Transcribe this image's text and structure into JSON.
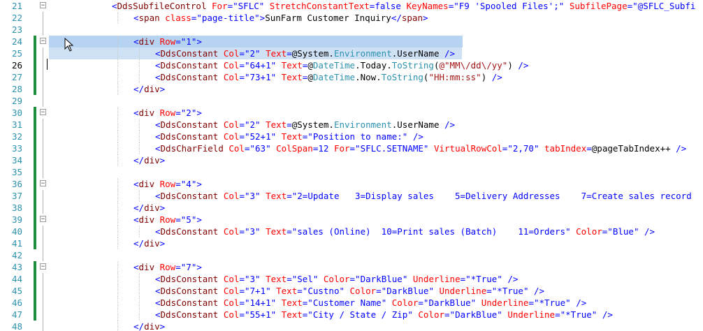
{
  "lines": [
    {
      "num": "21",
      "fold": "minus",
      "indent": 0,
      "tokens": [
        [
          "p",
          "<"
        ],
        [
          "t",
          "DdsSubfileControl"
        ],
        [
          "a",
          " For"
        ],
        [
          "p",
          "=\""
        ],
        [
          "v",
          "SFLC"
        ],
        [
          "p",
          "\""
        ],
        [
          "a",
          " StretchConstantText"
        ],
        [
          "p",
          "="
        ],
        [
          "v",
          "false"
        ],
        [
          "a",
          " KeyNames"
        ],
        [
          "p",
          "=\""
        ],
        [
          "v",
          "F9 'Spooled Files';"
        ],
        [
          "p",
          "\""
        ],
        [
          "a",
          " SubfilePage"
        ],
        [
          "p",
          "=\""
        ],
        [
          "v",
          "@SFLC_Subfi"
        ]
      ]
    },
    {
      "num": "22",
      "fold": "",
      "indent": 1,
      "tokens": [
        [
          "p",
          "<"
        ],
        [
          "t",
          "span"
        ],
        [
          "a",
          " class"
        ],
        [
          "p",
          "=\""
        ],
        [
          "v",
          "page-title"
        ],
        [
          "p",
          "\">"
        ],
        [
          "n",
          "SunFarm Customer Inquiry"
        ],
        [
          "p",
          "</"
        ],
        [
          "t",
          "span"
        ],
        [
          "p",
          ">"
        ]
      ]
    },
    {
      "num": "23",
      "fold": "",
      "indent": 0,
      "tokens": []
    },
    {
      "num": "24",
      "fold": "minus",
      "indent": 1,
      "tokens": [
        [
          "p",
          "<"
        ],
        [
          "t",
          "div"
        ],
        [
          "a",
          " Row"
        ],
        [
          "p",
          "=\""
        ],
        [
          "v",
          "1"
        ],
        [
          "p",
          "\">"
        ]
      ]
    },
    {
      "num": "25",
      "fold": "",
      "indent": 2,
      "tokens": [
        [
          "p",
          "<"
        ],
        [
          "t",
          "DdsConstant"
        ],
        [
          "a",
          " Col"
        ],
        [
          "p",
          "=\""
        ],
        [
          "v",
          "2"
        ],
        [
          "p",
          "\""
        ],
        [
          "a",
          " Text"
        ],
        [
          "p",
          "="
        ],
        [
          "n",
          "@System."
        ],
        [
          "k",
          "Environment"
        ],
        [
          "n",
          ".UserName"
        ],
        [
          "p",
          " />"
        ]
      ]
    },
    {
      "num": "26",
      "fold": "",
      "indent": 2,
      "tokens": [
        [
          "p",
          "<"
        ],
        [
          "t",
          "DdsConstant"
        ],
        [
          "a",
          " Col"
        ],
        [
          "p",
          "=\""
        ],
        [
          "v",
          "64+1"
        ],
        [
          "p",
          "\""
        ],
        [
          "a",
          " Text"
        ],
        [
          "p",
          "="
        ],
        [
          "n",
          "@"
        ],
        [
          "k",
          "DateTime"
        ],
        [
          "n",
          ".Today."
        ],
        [
          "k",
          "ToString"
        ],
        [
          "n",
          "("
        ],
        [
          "s",
          "@\"MM\\/dd\\/yy\""
        ],
        [
          "n",
          ")"
        ],
        [
          "p",
          " />"
        ]
      ]
    },
    {
      "num": "27",
      "fold": "",
      "indent": 2,
      "tokens": [
        [
          "p",
          "<"
        ],
        [
          "t",
          "DdsConstant"
        ],
        [
          "a",
          " Col"
        ],
        [
          "p",
          "=\""
        ],
        [
          "v",
          "73+1"
        ],
        [
          "p",
          "\""
        ],
        [
          "a",
          " Text"
        ],
        [
          "p",
          "="
        ],
        [
          "n",
          "@"
        ],
        [
          "k",
          "DateTime"
        ],
        [
          "n",
          ".Now."
        ],
        [
          "k",
          "ToString"
        ],
        [
          "n",
          "("
        ],
        [
          "s",
          "\"HH:mm:ss\""
        ],
        [
          "n",
          ")"
        ],
        [
          "p",
          " />"
        ]
      ]
    },
    {
      "num": "28",
      "fold": "",
      "indent": 1,
      "tokens": [
        [
          "p",
          "</"
        ],
        [
          "t",
          "div"
        ],
        [
          "p",
          ">"
        ]
      ]
    },
    {
      "num": "29",
      "fold": "",
      "indent": 0,
      "tokens": []
    },
    {
      "num": "30",
      "fold": "minus",
      "indent": 1,
      "tokens": [
        [
          "p",
          "<"
        ],
        [
          "t",
          "div"
        ],
        [
          "a",
          " Row"
        ],
        [
          "p",
          "=\""
        ],
        [
          "v",
          "2"
        ],
        [
          "p",
          "\">"
        ]
      ]
    },
    {
      "num": "31",
      "fold": "",
      "indent": 2,
      "tokens": [
        [
          "p",
          "<"
        ],
        [
          "t",
          "DdsConstant"
        ],
        [
          "a",
          " Col"
        ],
        [
          "p",
          "=\""
        ],
        [
          "v",
          "2"
        ],
        [
          "p",
          "\""
        ],
        [
          "a",
          " Text"
        ],
        [
          "p",
          "="
        ],
        [
          "n",
          "@System."
        ],
        [
          "k",
          "Environment"
        ],
        [
          "n",
          ".UserName"
        ],
        [
          "p",
          " />"
        ]
      ]
    },
    {
      "num": "32",
      "fold": "",
      "indent": 2,
      "tokens": [
        [
          "p",
          "<"
        ],
        [
          "t",
          "DdsConstant"
        ],
        [
          "a",
          " Col"
        ],
        [
          "p",
          "=\""
        ],
        [
          "v",
          "52+1"
        ],
        [
          "p",
          "\""
        ],
        [
          "a",
          " Text"
        ],
        [
          "p",
          "=\""
        ],
        [
          "v",
          "Position to name:"
        ],
        [
          "p",
          "\""
        ],
        [
          "p",
          " />"
        ]
      ]
    },
    {
      "num": "33",
      "fold": "",
      "indent": 2,
      "tokens": [
        [
          "p",
          "<"
        ],
        [
          "t",
          "DdsCharField"
        ],
        [
          "a",
          " Col"
        ],
        [
          "p",
          "=\""
        ],
        [
          "v",
          "63"
        ],
        [
          "p",
          "\""
        ],
        [
          "a",
          " ColSpan"
        ],
        [
          "p",
          "="
        ],
        [
          "v",
          "12"
        ],
        [
          "a",
          " For"
        ],
        [
          "p",
          "=\""
        ],
        [
          "v",
          "SFLC.SETNAME"
        ],
        [
          "p",
          "\""
        ],
        [
          "a",
          " VirtualRowCol"
        ],
        [
          "p",
          "=\""
        ],
        [
          "v",
          "2,70"
        ],
        [
          "p",
          "\""
        ],
        [
          "a",
          " tabIndex"
        ],
        [
          "p",
          "="
        ],
        [
          "n",
          "@pageTabIndex++"
        ],
        [
          "p",
          " />"
        ]
      ]
    },
    {
      "num": "34",
      "fold": "",
      "indent": 1,
      "tokens": [
        [
          "p",
          "</"
        ],
        [
          "t",
          "div"
        ],
        [
          "p",
          ">"
        ]
      ]
    },
    {
      "num": "35",
      "fold": "",
      "indent": 0,
      "tokens": []
    },
    {
      "num": "36",
      "fold": "minus",
      "indent": 1,
      "tokens": [
        [
          "p",
          "<"
        ],
        [
          "t",
          "div"
        ],
        [
          "a",
          " Row"
        ],
        [
          "p",
          "=\""
        ],
        [
          "v",
          "4"
        ],
        [
          "p",
          "\">"
        ]
      ]
    },
    {
      "num": "37",
      "fold": "",
      "indent": 2,
      "tokens": [
        [
          "p",
          "<"
        ],
        [
          "t",
          "DdsConstant"
        ],
        [
          "a",
          " Col"
        ],
        [
          "p",
          "=\""
        ],
        [
          "v",
          "3"
        ],
        [
          "p",
          "\""
        ],
        [
          "a",
          " Text"
        ],
        [
          "p",
          "=\""
        ],
        [
          "v",
          "2=Update   3=Display sales    5=Delivery Addresses    7=Create sales record"
        ]
      ]
    },
    {
      "num": "38",
      "fold": "",
      "indent": 1,
      "tokens": [
        [
          "p",
          "</"
        ],
        [
          "t",
          "div"
        ],
        [
          "p",
          ">"
        ]
      ]
    },
    {
      "num": "39",
      "fold": "minus",
      "indent": 1,
      "tokens": [
        [
          "p",
          "<"
        ],
        [
          "t",
          "div"
        ],
        [
          "a",
          " Row"
        ],
        [
          "p",
          "=\""
        ],
        [
          "v",
          "5"
        ],
        [
          "p",
          "\">"
        ]
      ]
    },
    {
      "num": "40",
      "fold": "",
      "indent": 2,
      "tokens": [
        [
          "p",
          "<"
        ],
        [
          "t",
          "DdsConstant"
        ],
        [
          "a",
          " Col"
        ],
        [
          "p",
          "=\""
        ],
        [
          "v",
          "3"
        ],
        [
          "p",
          "\""
        ],
        [
          "a",
          " Text"
        ],
        [
          "p",
          "=\""
        ],
        [
          "v",
          "sales (Online)  10=Print sales (Batch)    11=Orders"
        ],
        [
          "p",
          "\""
        ],
        [
          "a",
          " Color"
        ],
        [
          "p",
          "=\""
        ],
        [
          "v",
          "Blue"
        ],
        [
          "p",
          "\""
        ],
        [
          "p",
          " />"
        ]
      ]
    },
    {
      "num": "41",
      "fold": "",
      "indent": 1,
      "tokens": [
        [
          "p",
          "</"
        ],
        [
          "t",
          "div"
        ],
        [
          "p",
          ">"
        ]
      ]
    },
    {
      "num": "42",
      "fold": "",
      "indent": 0,
      "tokens": []
    },
    {
      "num": "43",
      "fold": "minus",
      "indent": 1,
      "tokens": [
        [
          "p",
          "<"
        ],
        [
          "t",
          "div"
        ],
        [
          "a",
          " Row"
        ],
        [
          "p",
          "=\""
        ],
        [
          "v",
          "7"
        ],
        [
          "p",
          "\">"
        ]
      ]
    },
    {
      "num": "44",
      "fold": "",
      "indent": 2,
      "tokens": [
        [
          "p",
          "<"
        ],
        [
          "t",
          "DdsConstant"
        ],
        [
          "a",
          " Col"
        ],
        [
          "p",
          "=\""
        ],
        [
          "v",
          "3"
        ],
        [
          "p",
          "\""
        ],
        [
          "a",
          " Text"
        ],
        [
          "p",
          "=\""
        ],
        [
          "v",
          "Sel"
        ],
        [
          "p",
          "\""
        ],
        [
          "a",
          " Color"
        ],
        [
          "p",
          "=\""
        ],
        [
          "v",
          "DarkBlue"
        ],
        [
          "p",
          "\""
        ],
        [
          "a",
          " Underline"
        ],
        [
          "p",
          "=\""
        ],
        [
          "v",
          "*True"
        ],
        [
          "p",
          "\""
        ],
        [
          "p",
          " />"
        ]
      ]
    },
    {
      "num": "45",
      "fold": "",
      "indent": 2,
      "tokens": [
        [
          "p",
          "<"
        ],
        [
          "t",
          "DdsConstant"
        ],
        [
          "a",
          " Col"
        ],
        [
          "p",
          "=\""
        ],
        [
          "v",
          "7+1"
        ],
        [
          "p",
          "\""
        ],
        [
          "a",
          " Text"
        ],
        [
          "p",
          "=\""
        ],
        [
          "v",
          "Custno"
        ],
        [
          "p",
          "\""
        ],
        [
          "a",
          " Color"
        ],
        [
          "p",
          "=\""
        ],
        [
          "v",
          "DarkBlue"
        ],
        [
          "p",
          "\""
        ],
        [
          "a",
          " Underline"
        ],
        [
          "p",
          "=\""
        ],
        [
          "v",
          "*True"
        ],
        [
          "p",
          "\""
        ],
        [
          "p",
          " />"
        ]
      ]
    },
    {
      "num": "46",
      "fold": "",
      "indent": 2,
      "tokens": [
        [
          "p",
          "<"
        ],
        [
          "t",
          "DdsConstant"
        ],
        [
          "a",
          " Col"
        ],
        [
          "p",
          "=\""
        ],
        [
          "v",
          "14+1"
        ],
        [
          "p",
          "\""
        ],
        [
          "a",
          " Text"
        ],
        [
          "p",
          "=\""
        ],
        [
          "v",
          "Customer Name"
        ],
        [
          "p",
          "\""
        ],
        [
          "a",
          " Color"
        ],
        [
          "p",
          "=\""
        ],
        [
          "v",
          "DarkBlue"
        ],
        [
          "p",
          "\""
        ],
        [
          "a",
          " Underline"
        ],
        [
          "p",
          "=\""
        ],
        [
          "v",
          "*True"
        ],
        [
          "p",
          "\""
        ],
        [
          "p",
          " />"
        ]
      ]
    },
    {
      "num": "47",
      "fold": "",
      "indent": 2,
      "tokens": [
        [
          "p",
          "<"
        ],
        [
          "t",
          "DdsConstant"
        ],
        [
          "a",
          " Col"
        ],
        [
          "p",
          "=\""
        ],
        [
          "v",
          "55+1"
        ],
        [
          "p",
          "\""
        ],
        [
          "a",
          " Text"
        ],
        [
          "p",
          "=\""
        ],
        [
          "v",
          "City / State / Zip"
        ],
        [
          "p",
          "\""
        ],
        [
          "a",
          " Color"
        ],
        [
          "p",
          "=\""
        ],
        [
          "v",
          "DarkBlue"
        ],
        [
          "p",
          "\""
        ],
        [
          "a",
          " Underline"
        ],
        [
          "p",
          "=\""
        ],
        [
          "v",
          "*True"
        ],
        [
          "p",
          "\""
        ],
        [
          "p",
          " />"
        ]
      ]
    },
    {
      "num": "48",
      "fold": "",
      "indent": 1,
      "tokens": [
        [
          "p",
          "</"
        ],
        [
          "t",
          "div"
        ],
        [
          "p",
          ">"
        ]
      ]
    }
  ],
  "changed_lines": [
    "24",
    "25",
    "26",
    "27",
    "28",
    "30",
    "31",
    "32",
    "33",
    "34",
    "35",
    "36",
    "37",
    "38",
    "39",
    "40",
    "41",
    "43",
    "44",
    "45",
    "46",
    "47"
  ],
  "current_line": "26",
  "selected_lines": [
    "24",
    "25"
  ],
  "colors": {
    "tag": "#800000",
    "attribute": "#ff0000",
    "value": "#0000ff",
    "type": "#2b91af",
    "string": "#a31515",
    "line_number": "#2b91af",
    "change_bar": "#1e8e3e",
    "selection": "#b7d3f2"
  },
  "icons": {
    "fold_collapse": "minus-box-icon",
    "cursor": "arrow-cursor-icon"
  }
}
